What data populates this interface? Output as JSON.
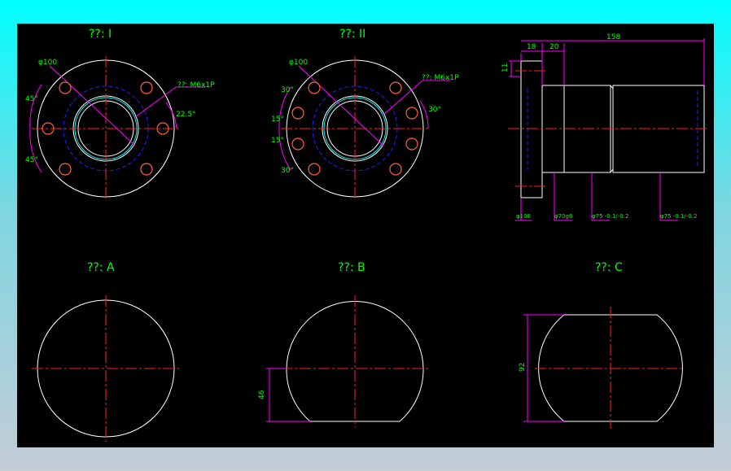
{
  "views": {
    "flange_1": {
      "title": "??: I",
      "dia": "φ100",
      "thread": "??: M6x1P",
      "angle_top": "45°",
      "angle_bottom": "45°",
      "angle_right": "22.5°"
    },
    "flange_2": {
      "title": "??: II",
      "dia": "φ100",
      "thread": "??: M6x1P",
      "angle_1": "30°",
      "angle_2": "15°",
      "angle_3": "15°",
      "angle_4": "30°",
      "angle_right": "30°"
    },
    "side": {
      "dim_18": "18",
      "dim_20": "20",
      "dim_158": "158",
      "dim_11": "11",
      "d1": "φ108",
      "d2": "φ70g6",
      "d3": "φ75 -0.1/-0.2",
      "d4": "φ75 -0.1/-0.2"
    },
    "section_a": {
      "title": "??: A"
    },
    "section_b": {
      "title": "??: B",
      "dim": "46"
    },
    "section_c": {
      "title": "??: C",
      "dim": "92"
    }
  },
  "colors": {
    "background": "#000000",
    "outline": "#ffffff",
    "center": "#ff2020",
    "hidden": "#2020ff",
    "dimension": "#ff00ff",
    "text": "#00ff00"
  }
}
